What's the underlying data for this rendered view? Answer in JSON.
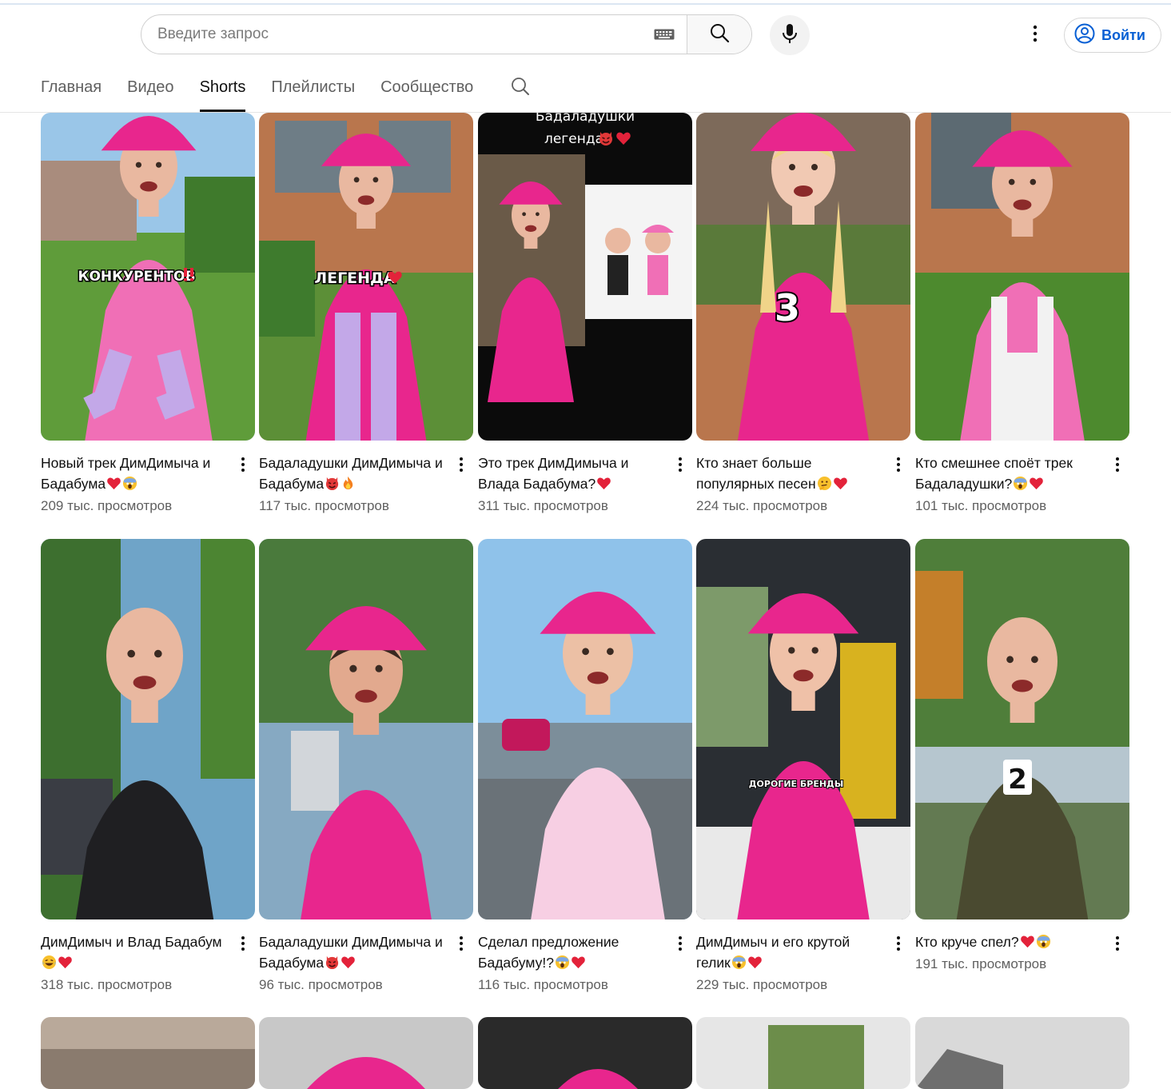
{
  "search": {
    "placeholder": "Введите запрос",
    "value": ""
  },
  "header": {
    "signin_label": "Войти"
  },
  "tabs": [
    {
      "label": "Главная",
      "active": false
    },
    {
      "label": "Видео",
      "active": false
    },
    {
      "label": "Shorts",
      "active": true
    },
    {
      "label": "Плейлисты",
      "active": false
    },
    {
      "label": "Сообщество",
      "active": false
    }
  ],
  "shorts": [
    {
      "title": "Новый трек ДимДимыча и Бадабума",
      "emojis": [
        "heart",
        "scream"
      ],
      "views": "209 тыс. просмотров",
      "overlay": "КОНКУРЕНТОВ",
      "overlay_emojis": [
        "double-exclamation"
      ]
    },
    {
      "title": "Бадаладушки ДимДимыча и Бадабума",
      "emojis": [
        "devil",
        "fire"
      ],
      "views": "117 тыс. просмотров",
      "overlay": "ЛЕГЕНДА",
      "overlay_emojis": [
        "heart"
      ]
    },
    {
      "title": "Это трек ДимДимыча и Влада Бадабума?",
      "emojis": [
        "heart"
      ],
      "views": "311 тыс. просмотров",
      "overlay": "Бадаладушки легенда",
      "overlay_emojis": [
        "devil",
        "heart"
      ]
    },
    {
      "title": "Кто знает больше популярных песен",
      "emojis": [
        "thinking",
        "heart"
      ],
      "views": "224 тыс. просмотров",
      "overlay": "3"
    },
    {
      "title": "Кто смешнее споёт трек Бадаладушки?",
      "emojis": [
        "scream",
        "heart"
      ],
      "views": "101 тыс. просмотров"
    },
    {
      "title": "ДимДимыч и Влад Бадабум",
      "emojis": [
        "laugh",
        "heart"
      ],
      "views": "318 тыс. просмотров"
    },
    {
      "title": "Бадаладушки ДимДимыча и Бадабума",
      "emojis": [
        "devil",
        "heart"
      ],
      "views": "96 тыс. просмотров"
    },
    {
      "title": "Сделал предложение Бадабуму!?",
      "emojis": [
        "scream",
        "heart"
      ],
      "views": "116 тыс. просмотров"
    },
    {
      "title": "ДимДимыч и его крутой гелик",
      "emojis": [
        "scream",
        "heart"
      ],
      "views": "229 тыс. просмотров",
      "overlay": "ДОРОГИЕ БРЕНДЫ"
    },
    {
      "title": "Кто круче спел?",
      "emojis": [
        "heart",
        "scream"
      ],
      "views": "191 тыс. просмотров",
      "overlay": "2"
    },
    {
      "title": "",
      "emojis": [],
      "views": ""
    },
    {
      "title": "",
      "emojis": [],
      "views": ""
    },
    {
      "title": "",
      "emojis": [],
      "views": ""
    },
    {
      "title": "",
      "emojis": [],
      "views": ""
    },
    {
      "title": "",
      "emojis": [],
      "views": ""
    }
  ],
  "colors": {
    "link_blue": "#065fd4",
    "pink": "#e8268d",
    "text_secondary": "#606060"
  }
}
